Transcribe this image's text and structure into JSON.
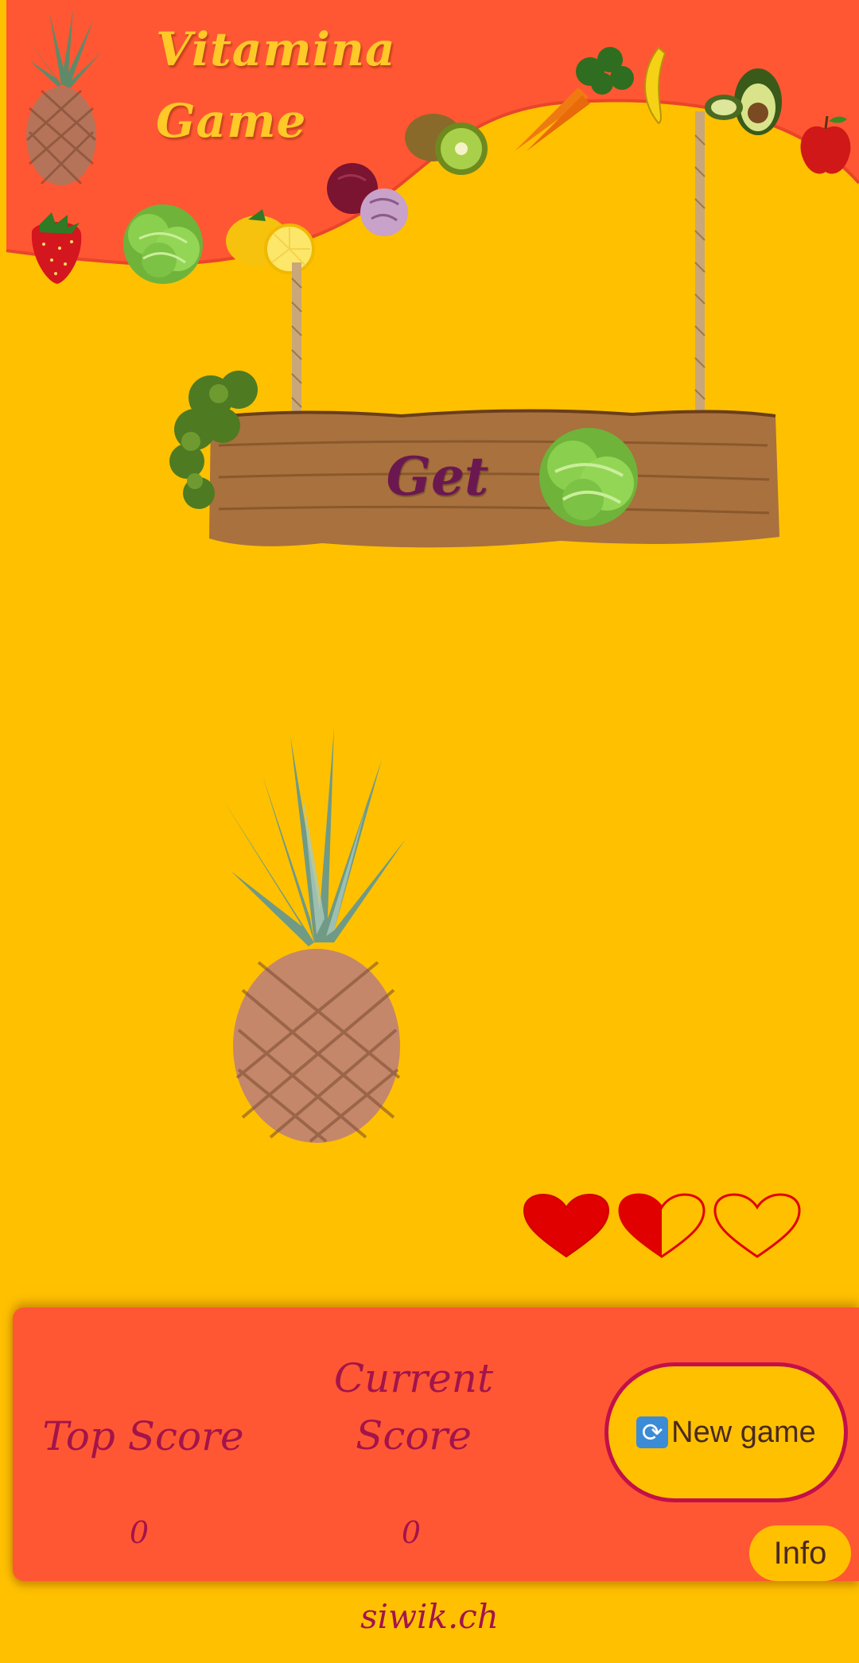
{
  "header": {
    "title_line1": "Vitamina",
    "title_line2": "Game"
  },
  "sign": {
    "text": "Get"
  },
  "game": {
    "falling_item_icon": "pineapple-icon",
    "lives": [
      {
        "state": "full",
        "icon": "heart-full-icon",
        "fill": 1.0
      },
      {
        "state": "half",
        "icon": "heart-half-icon",
        "fill": 0.5
      },
      {
        "state": "empty",
        "icon": "heart-empty-icon",
        "fill": 0.0
      }
    ]
  },
  "scoreboard": {
    "top_score_label": "Top Score",
    "current_score_label_line1": "Current",
    "current_score_label_line2": "Score",
    "top_score_value": "0",
    "current_score_value": "0",
    "new_game_label": "New game",
    "new_game_icon": "refresh-icon",
    "info_label": "Info"
  },
  "footer": {
    "text": "siwik.ch"
  },
  "colors": {
    "background": "#FFC000",
    "header_orange": "#FF5733",
    "accent_magenta": "#A3144B",
    "heart_red": "#E00000"
  }
}
